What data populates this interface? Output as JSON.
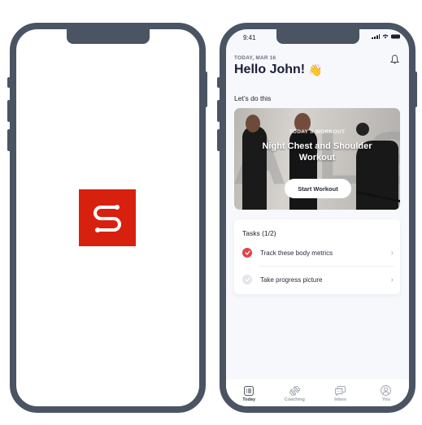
{
  "splash": {
    "logo_icon": "stylized-s-logo-icon",
    "brand_color": "#d8200f"
  },
  "status_bar": {
    "time": "9:41",
    "icons": [
      "signal-icon",
      "wifi-icon",
      "battery-icon"
    ]
  },
  "header": {
    "date_label": "TODAY, MAR 16",
    "greeting": "Hello John!",
    "greeting_emoji": "👋",
    "bell_icon": "bell-icon"
  },
  "section": {
    "title": "Let’s do this"
  },
  "workout": {
    "eyebrow": "TODAY'S WORKOUT",
    "title": "Night Chest and Shoulder Workout",
    "start_label": "Start Workout"
  },
  "tasks": {
    "title": "Tasks (1/2)",
    "items": [
      {
        "label": "Track these body metrics",
        "done": true
      },
      {
        "label": "Take progress picture",
        "done": false
      }
    ],
    "done_color": "#e0434a",
    "pending_color": "#e3e5e9"
  },
  "tabbar": {
    "items": [
      {
        "label": "Today",
        "icon": "list-icon",
        "active": true
      },
      {
        "label": "Coaching",
        "icon": "dumbbell-icon",
        "active": false
      },
      {
        "label": "Inbox",
        "icon": "chat-icon",
        "active": false
      },
      {
        "label": "You",
        "icon": "user-icon",
        "active": false
      }
    ]
  }
}
